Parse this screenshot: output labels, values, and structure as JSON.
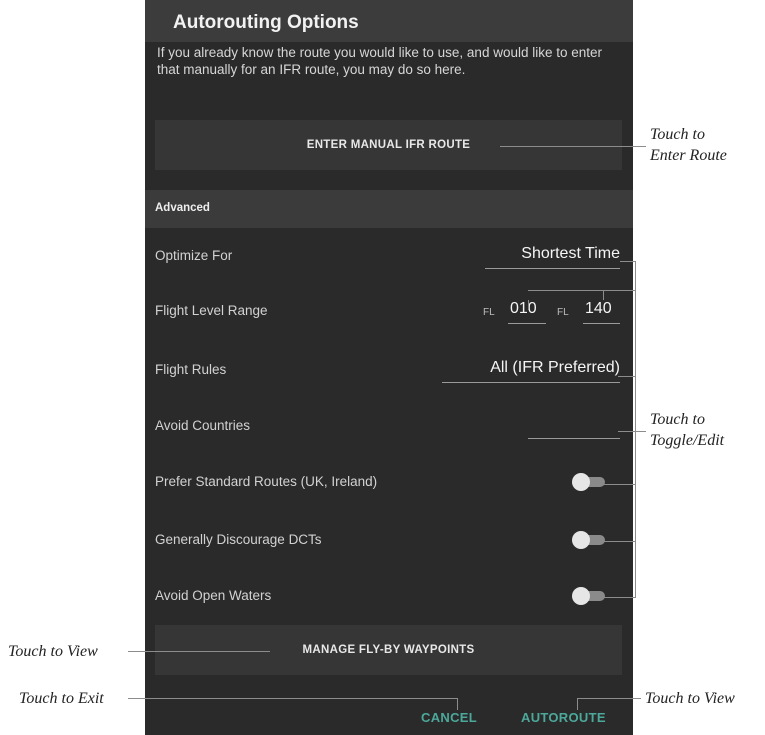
{
  "dialog": {
    "title": "Autorouting Options",
    "intro_text": "If you already know the route you would like to use, and would like to enter that manually for an IFR route, you may do so here.",
    "enter_manual_button": "ENTER MANUAL IFR ROUTE",
    "section_header": "Advanced",
    "rows": {
      "optimize_for": {
        "label": "Optimize For",
        "value": "Shortest Time"
      },
      "flight_level_range": {
        "label": "Flight Level Range",
        "fl_prefix": "FL",
        "min": "010",
        "max": "140"
      },
      "flight_rules": {
        "label": "Flight Rules",
        "value": "All (IFR Preferred)"
      },
      "avoid_countries": {
        "label": "Avoid Countries",
        "value": ""
      },
      "prefer_standard_routes": {
        "label": "Prefer Standard Routes (UK, Ireland)",
        "on": false
      },
      "discourage_dcts": {
        "label": "Generally Discourage DCTs",
        "on": false
      },
      "avoid_open_waters": {
        "label": "Avoid Open Waters",
        "on": false
      }
    },
    "manage_waypoints_button": "MANAGE FLY-BY WAYPOINTS",
    "cancel_button": "CANCEL",
    "autoroute_button": "AUTOROUTE"
  },
  "callouts": {
    "enter_route": "Touch to\nEnter Route",
    "toggle_edit": "Touch to\nToggle/Edit",
    "view_waypoints": "Touch to View",
    "exit": "Touch to Exit",
    "view_route": "Touch to View"
  },
  "colors": {
    "panel": "#2a2a2a",
    "accent": "#4ca89a"
  }
}
